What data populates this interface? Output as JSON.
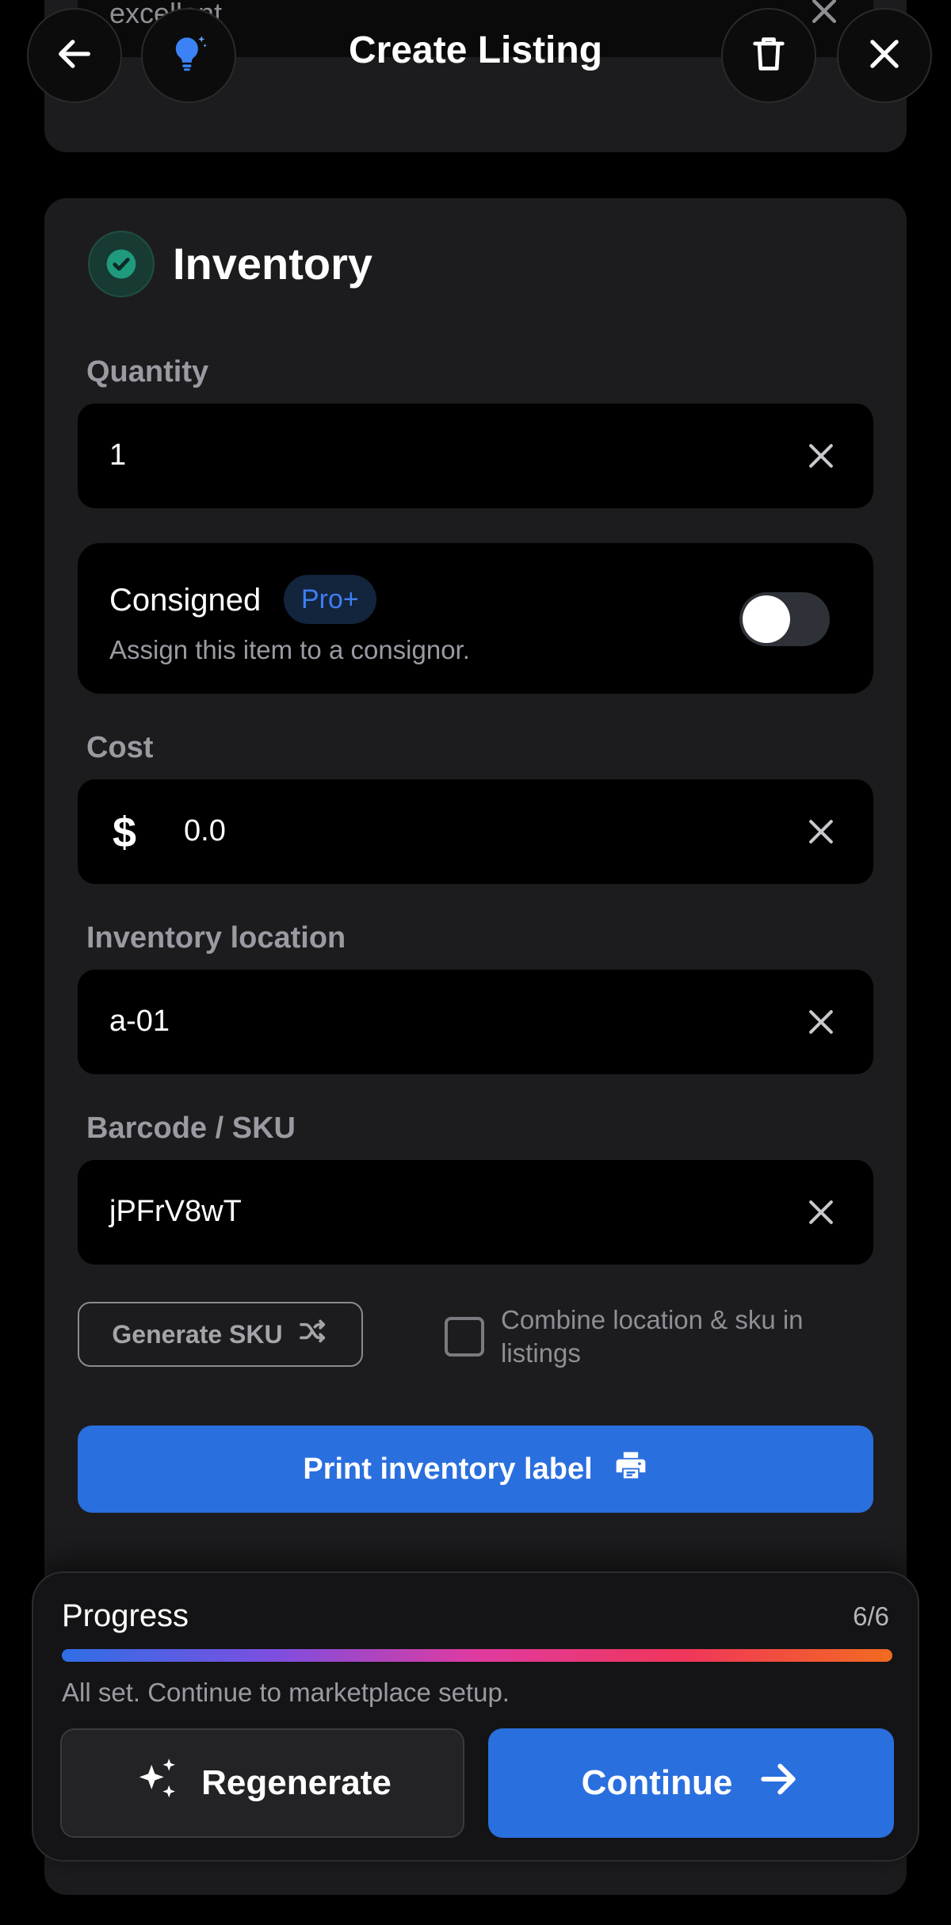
{
  "header": {
    "title": "Create Listing",
    "back_icon": "arrow-left-icon",
    "tips_icon": "lightbulb-icon",
    "delete_icon": "trash-icon",
    "close_icon": "close-icon"
  },
  "previous_section": {
    "partial_value": "excellent"
  },
  "inventory": {
    "title": "Inventory",
    "status_icon": "check-circle-icon",
    "quantity": {
      "label": "Quantity",
      "value": "1"
    },
    "consigned": {
      "title": "Consigned",
      "badge": "Pro+",
      "description": "Assign this item to a consignor.",
      "enabled": false
    },
    "cost": {
      "label": "Cost",
      "currency_symbol": "$",
      "value": "0.0"
    },
    "location": {
      "label": "Inventory location",
      "value": "a-01"
    },
    "sku": {
      "label": "Barcode / SKU",
      "value": "jPFrV8wT"
    },
    "generate_sku_label": "Generate SKU",
    "combine_label": "Combine location & sku in listings",
    "combine_checked": false,
    "print_label": "Print inventory label"
  },
  "progress": {
    "label": "Progress",
    "count": "6/6",
    "fraction": 1.0,
    "message": "All set. Continue to marketplace setup.",
    "regenerate_label": "Regenerate",
    "continue_label": "Continue"
  },
  "colors": {
    "accent": "#2a6fde",
    "success": "#1f9a7c",
    "pro_badge": "#3d7ef0"
  }
}
